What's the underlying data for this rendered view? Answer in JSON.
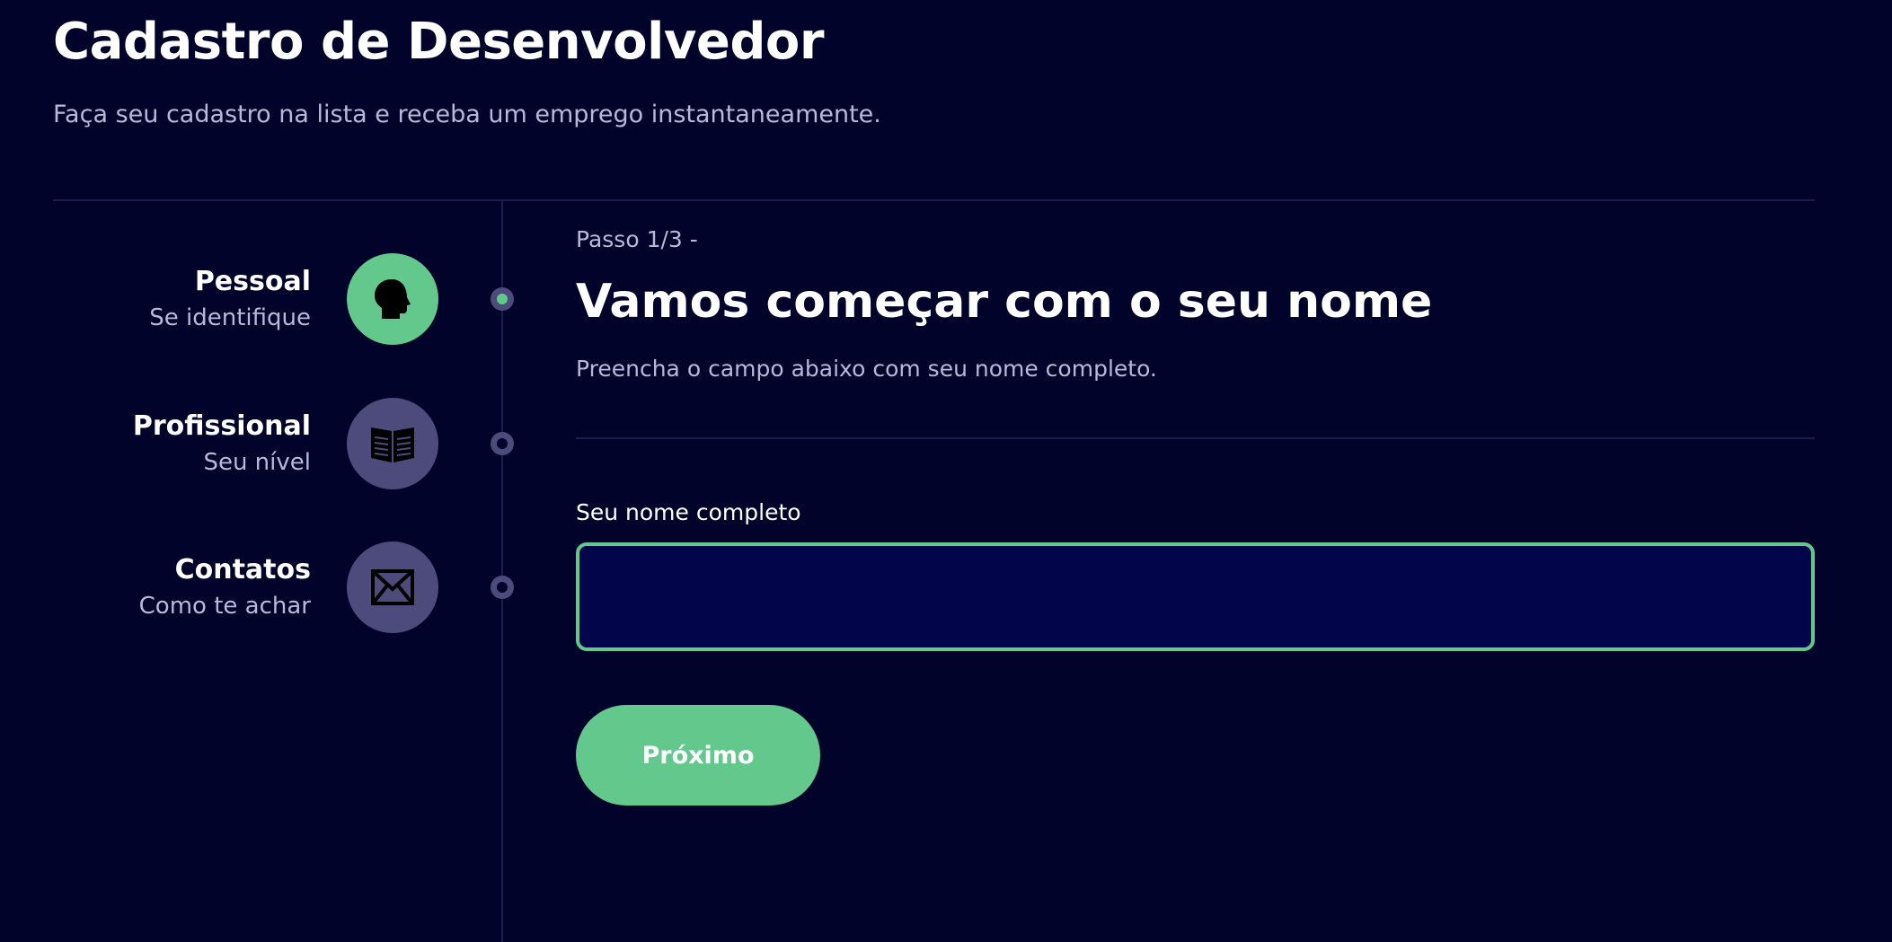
{
  "header": {
    "title": "Cadastro de Desenvolvedor",
    "subtitle": "Faça seu cadastro na lista e receba um emprego instantaneamente."
  },
  "steps": [
    {
      "title": "Pessoal",
      "description": "Se identifique",
      "icon": "head-icon",
      "active": true
    },
    {
      "title": "Profissional",
      "description": "Seu nível",
      "icon": "book-icon",
      "active": false
    },
    {
      "title": "Contatos",
      "description": "Como te achar",
      "icon": "envelope-icon",
      "active": false
    }
  ],
  "form": {
    "step_counter": "Passo 1/3 -",
    "title": "Vamos começar com o seu nome",
    "description": "Preencha o campo abaixo com seu nome completo.",
    "field_label": "Seu nome completo",
    "field_value": "",
    "next_label": "Próximo"
  },
  "colors": {
    "background": "#02032a",
    "accent": "#62c88c",
    "inactive": "#4c4b7c",
    "input_background": "#03054a",
    "muted_text": "#b8b8da"
  }
}
